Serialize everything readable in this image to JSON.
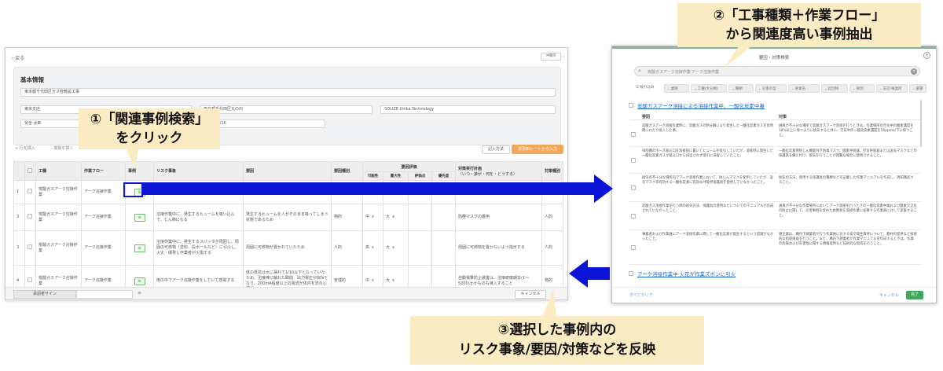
{
  "left_window": {
    "back_label": "‹ 戻る",
    "edit_label": "沖縄県",
    "basic_title": "基本情報",
    "fields": {
      "project_name": "東京都千代田区ガス管敷設工事",
      "branch": "東京支店",
      "location": "東京都千代田区丸の内",
      "company": "SOLIZE Unika Technology",
      "person": "安全 太郎",
      "date": "2024/07/16"
    },
    "toolbar": {
      "add_row": "+ 行を挿入",
      "delete_row": "- 複製を挿入",
      "method": "記入方法",
      "import": "票票Blシートから入力"
    },
    "table": {
      "headers": {
        "work": "工種",
        "flow": "作業フロー",
        "case": "事例",
        "risk": "リスク事象",
        "factor": "要因",
        "factor_type": "要因種別",
        "evaluation": "要因評価",
        "likelihood": "可能性",
        "severity": "重大性",
        "score": "評価点",
        "priority": "優先度",
        "plan": "対策実行計画",
        "plan_sub": "（いつ・誰が・何を・どうする）",
        "target": "対策種別"
      },
      "rows": [
        {
          "no": "1",
          "work": "炭酸ガスアーク溶接作業",
          "flow": "アーク溶接作業",
          "risk": "",
          "factor": "",
          "factor_type": "",
          "likelihood": "",
          "severity": "",
          "plan": "",
          "target": ""
        },
        {
          "no": "3",
          "work": "炭酸ガスアーク溶接作業",
          "flow": "アーク溶接作業",
          "risk": "溶接作業中に、発生するヒュームを吸い込んで、じん肺になる",
          "factor": "発生するヒュームを人がそのまま吸ってしまう状態であるため",
          "factor_type": "物的",
          "likelihood": "中",
          "severity": "大",
          "plan": "防塵マスクの着用",
          "target": "人的"
        },
        {
          "no": "3",
          "work": "炭酸ガスアーク溶接作業",
          "flow": "アーク溶接作業",
          "risk": "溶接作業中に、発生するスパッタが周囲し、周囲の可燃物（塗料、段ボールなど）に引火し、火災・爆発し作業者が火傷する",
          "factor": "周囲に可燃物が置かれていたため",
          "factor_type": "人的",
          "likelihood": "高",
          "severity": "大",
          "plan": "周囲に可燃物を置かないよう指示する",
          "target": "人的"
        },
        {
          "no": "4",
          "work": "炭酸ガスアーク溶接作業",
          "flow": "アーク溶接作業",
          "risk": "雨の中でアーク溶接作業をしていて感電する",
          "factor": "体の抵抗は水に濡れて1/10以下となっていたため、溶接棒に触れた瞬間、出力電圧が80Vとなり、200mA程度以上の電流が体内を流れ心臓に...",
          "factor_type": "管理的",
          "likelihood": "中",
          "severity": "大",
          "plan": "自動電撃防止装置は、溶接統御期日(1～5000)かかものも導入すること",
          "target": "物的"
        }
      ]
    },
    "footer": {
      "sign": "承認者サイン",
      "cancel": "キャンセル"
    }
  },
  "right_window": {
    "title": "要因・対策検索",
    "search_query": "炭酸ガスアーク溶接作業 アーク溶接作業",
    "filters": {
      "narrow": "絞り込み",
      "f1": "業務",
      "f2": "工種(大分類)",
      "f3": "種類",
      "f4": "災害の型",
      "f5": "要素名",
      "f6": "起因物",
      "f7": "要因",
      "f8": "支店/事業所",
      "f9": "部署"
    },
    "section1": "炭酸ガスアーク溶接による溶接作業中、一酸化炭素中毒",
    "head_cause": "要因",
    "head_measure": "対策",
    "results": [
      {
        "cause": "炭酸ガスアーク溶接作業時に、炭酸ガスの熱分解により発生した一酸化炭素ガスを長時間にわたり吸入した事。",
        "measure": "通風が不十分な場所で炭酸ガスアーク溶接を行うときは、作業場所の空気中の酸素濃度を18%以上に保つように換気すると共に、空気中の一酸化炭素濃度を50ppm以下に保つこと。"
      },
      {
        "cause": "排除機のホース吸込口を溶接部に置いてヒュームを吸引していたが、溶接時に発生した一酸化炭素ガスが吸込口から排出されず吸引に滞留していたこと。",
        "measure": "一酸化炭素用防じん機能付き防毒マスク、酸素呼吸器、空気呼吸器または送気マスクなどの保護具を備え付け、換気を行うことが困難な場合に使用させること。"
      },
      {
        "cause": "換気の不十分な場所内でアーク溶接作業において、防じんマスクを使用していたが、送気マスク等有効する一酸化炭素に有効な呼吸用保護具を使用していなかったこと。",
        "measure": "換気の方法、使用する保護具の種類などを記載した作業マニュアルを作成し、周知徹底すること。"
      },
      {
        "cause": "炭酸ガス溶接作業を行う際の換気方法、保護具の使用などについてのマニュアルが作成されていなかったこと。",
        "measure": "通風が不十分な作業場所においてアーク溶接を行うときの一酸化炭素中毒および酸素欠乏症の防止に関して、災害事例を含めた具教育を溶接作業に従事する作業員に対して実施すること。"
      },
      {
        "cause": "事業者および作業員にアーク溶接作業に際して一酸化炭素が発生するという認識がなかったこと。",
        "measure": "親企業は、構内下請業者が行う作業員に対する安全衛生教育について、教材の提供など技術的な指導援助を行うこと。また、構内下請業者が作業マニュアルを作成するときは、作業の危険および有害性に関する情報提供など技術的な指導を行うこと。"
      }
    ],
    "section2": "アーク溶接作業中 火花が作業ズボンに引火",
    "footer": {
      "clear": "すべてクリア",
      "cancel": "キャンセル",
      "done": "完了"
    }
  },
  "callouts": {
    "step1_line1": "①「関連事例検索」",
    "step1_line2": "をクリック",
    "step2_line1": "②「工事種類＋作業フロー」",
    "step2_line2": "から関連度高い事例抽出",
    "step3_line1": "③選択した事例内の",
    "step3_line2": "リスク事象/要因/対策などを反映"
  },
  "colors": {
    "arrow_blue": "#0c14d8",
    "callout_bg": "#fbebc3",
    "import_button": "#f2a85a",
    "done_button": "#3fa85a",
    "link_blue": "#1a66c8"
  }
}
